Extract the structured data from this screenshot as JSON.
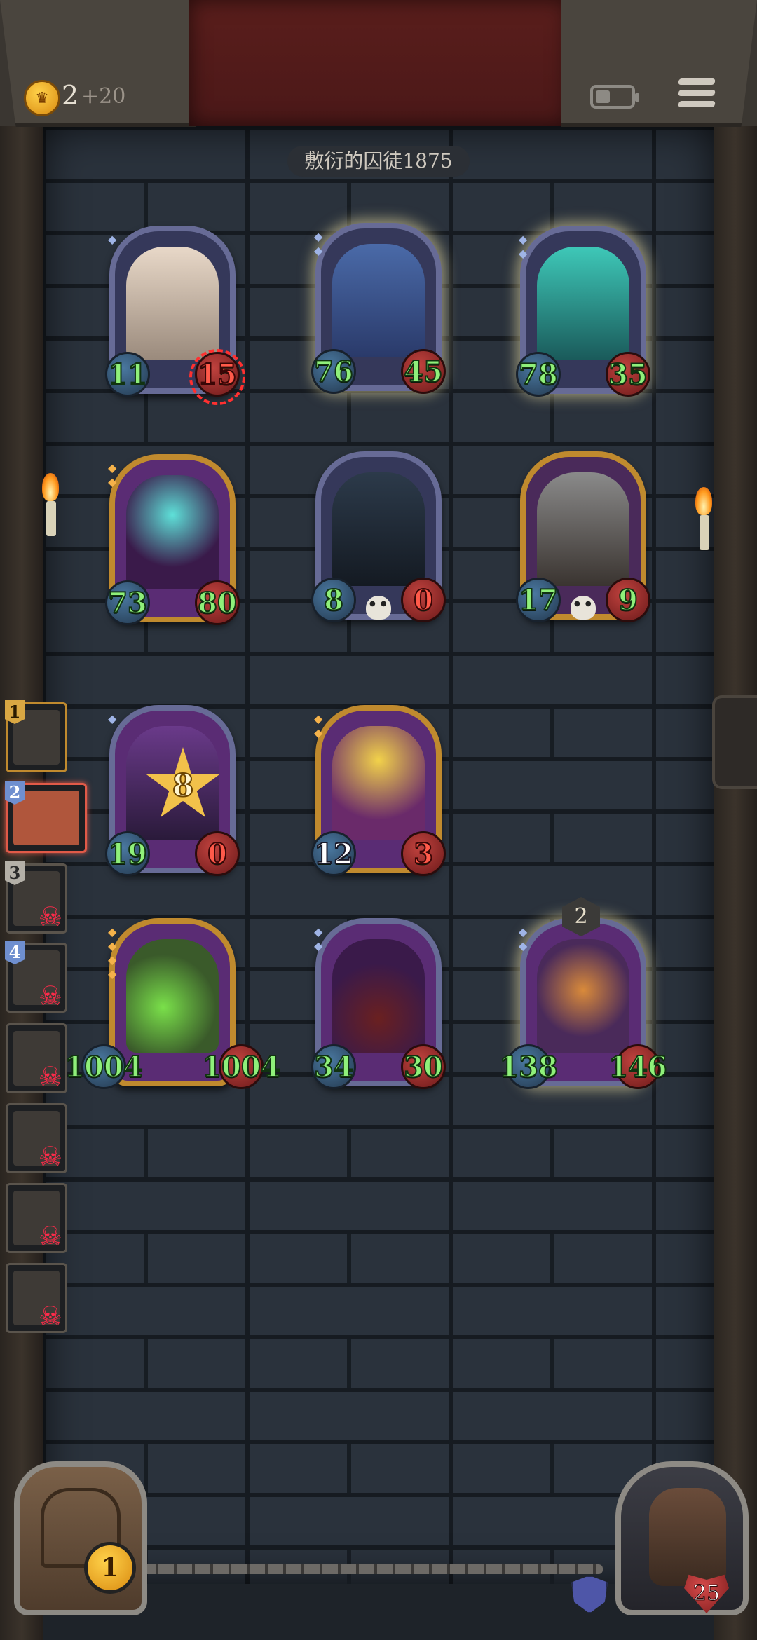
{
  "header": {
    "gold": "2",
    "gold_bonus": "+20",
    "icons": {
      "coin": "crown-coin-icon",
      "battery": "battery-icon",
      "menu": "menu-icon"
    }
  },
  "opponent": {
    "name": "敷衍的囚徒1875"
  },
  "board": {
    "opponent_row": [
      {
        "name": "goggle-pirate-minion",
        "attack": "11",
        "health": "15",
        "tier_pips": 1,
        "frame": "blue"
      },
      {
        "name": "armored-knight-minion",
        "attack": "76",
        "health": "45",
        "tier_pips": 2,
        "frame": "blue"
      },
      {
        "name": "ghost-samurai-minion",
        "attack": "78",
        "health": "35",
        "tier_pips": 2,
        "frame": "blue"
      }
    ],
    "opponent_row_2": [
      {
        "name": "spirit-flame-minion",
        "attack": "73",
        "health": "80",
        "tier_pips": 2,
        "frame": "gold"
      },
      {
        "name": "crow-minion",
        "attack": "8",
        "health": "0",
        "frame": "blue"
      },
      {
        "name": "mech-rat-minion",
        "attack": "17",
        "health": "9",
        "frame": "gold"
      }
    ],
    "player_row": [
      {
        "name": "shadow-dragon-minion",
        "attack": "19",
        "health": "0",
        "damage": "8",
        "frame": "blue"
      },
      {
        "name": "fire-queen-minion",
        "attack": "12",
        "health": "3",
        "frame": "gold"
      }
    ],
    "player_row_2": [
      {
        "name": "slime-dragon-minion",
        "attack": "1004",
        "health": "1004",
        "frame": "gold"
      },
      {
        "name": "scorpion-minion",
        "attack": "34",
        "health": "30",
        "frame": "blue"
      },
      {
        "name": "pumpkin-minion",
        "attack": "138",
        "health": "146",
        "badge": "2",
        "frame": "blue"
      }
    ]
  },
  "players": [
    {
      "rank": "1",
      "status": "alive"
    },
    {
      "rank": "2",
      "status": "active"
    },
    {
      "rank": "3",
      "status": "dead"
    },
    {
      "rank": "4",
      "status": "dead"
    },
    {
      "rank": "",
      "status": "dead"
    },
    {
      "rank": "",
      "status": "dead"
    },
    {
      "rank": "",
      "status": "dead"
    },
    {
      "rank": "",
      "status": "dead"
    }
  ],
  "bottom": {
    "chest_coins": "1",
    "hero_health": "25",
    "icons": {
      "chest": "treasure-chest-icon",
      "shield": "shield-icon",
      "hero": "goat-hero-portrait"
    }
  }
}
